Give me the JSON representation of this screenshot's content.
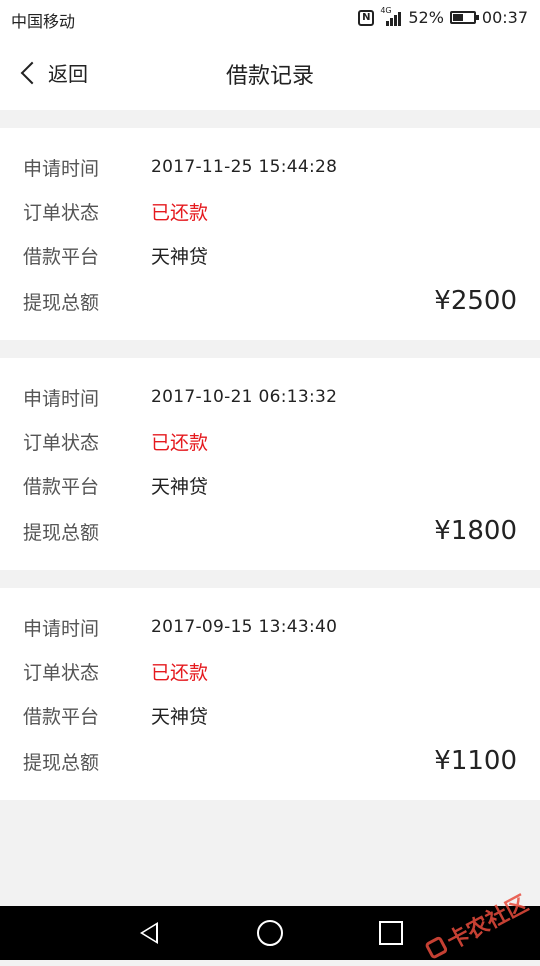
{
  "status_bar": {
    "carrier": "中国移动",
    "network": "4G",
    "battery_percent_text": "52%",
    "battery_level": 0.52,
    "time": "00:37"
  },
  "nav": {
    "back_label": "返回",
    "title": "借款记录"
  },
  "labels": {
    "apply_time": "申请时间",
    "order_status": "订单状态",
    "platform": "借款平台",
    "total_amount": "提现总额"
  },
  "records": [
    {
      "apply_time": "2017-11-25 15:44:28",
      "status": "已还款",
      "platform": "天神贷",
      "amount": "¥2500"
    },
    {
      "apply_time": "2017-10-21 06:13:32",
      "status": "已还款",
      "platform": "天神贷",
      "amount": "¥1800"
    },
    {
      "apply_time": "2017-09-15 13:43:40",
      "status": "已还款",
      "platform": "天神贷",
      "amount": "¥1100"
    }
  ],
  "watermark": "卡农社区",
  "colors": {
    "status_paid": "#e5191e",
    "background": "#f2f2f2",
    "card": "#ffffff"
  }
}
